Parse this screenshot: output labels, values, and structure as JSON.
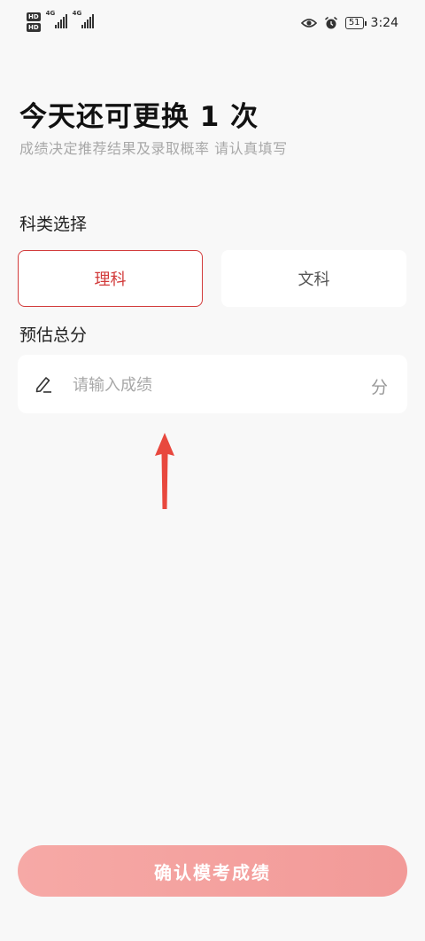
{
  "status_bar": {
    "hd_badge": "HD",
    "signal_label": "4G",
    "battery": "51",
    "time": "3:24"
  },
  "header": {
    "title": "今天还可更换 1 次",
    "subtitle": "成绩决定推荐结果及录取概率  请认真填写"
  },
  "subject": {
    "label": "科类选择",
    "options": [
      {
        "label": "理科",
        "selected": true
      },
      {
        "label": "文科",
        "selected": false
      }
    ]
  },
  "score": {
    "label": "预估总分",
    "placeholder": "请输入成绩",
    "value": "",
    "unit": "分"
  },
  "confirm_button": {
    "label": "确认模考成绩"
  },
  "colors": {
    "accent": "#d23b3b",
    "button_gradient_start": "#f6a9a6",
    "button_gradient_end": "#f29a98",
    "annotation_arrow": "#e8483e",
    "background": "#f8f8f8"
  }
}
